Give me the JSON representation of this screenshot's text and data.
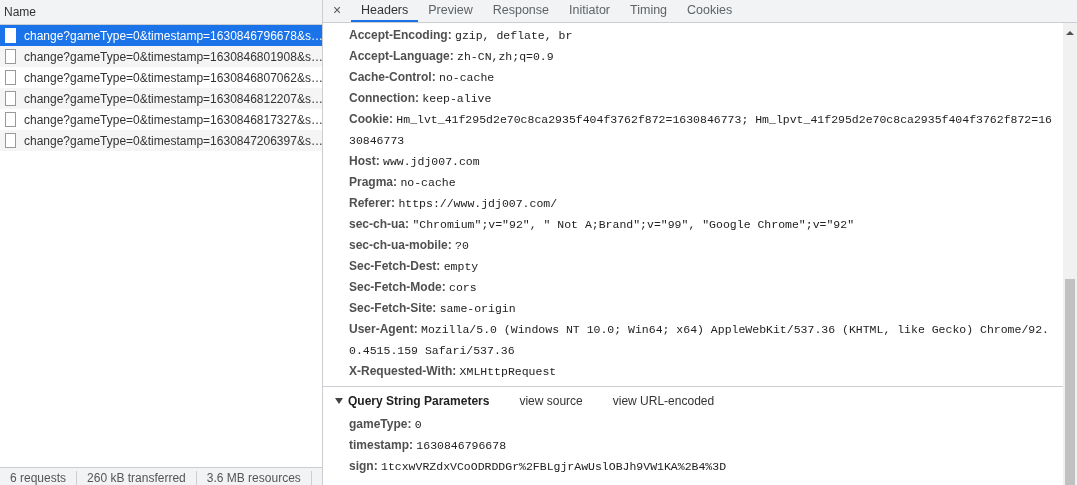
{
  "request_list": {
    "column_header": "Name",
    "requests": [
      {
        "name": "change?gameType=0&timestamp=1630846796678&s…",
        "selected": true
      },
      {
        "name": "change?gameType=0&timestamp=1630846801908&s…",
        "selected": false
      },
      {
        "name": "change?gameType=0&timestamp=1630846807062&s…",
        "selected": false
      },
      {
        "name": "change?gameType=0&timestamp=1630846812207&s…",
        "selected": false
      },
      {
        "name": "change?gameType=0&timestamp=1630846817327&s…",
        "selected": false
      },
      {
        "name": "change?gameType=0&timestamp=1630847206397&s…",
        "selected": false
      }
    ]
  },
  "status_bar": [
    "6 requests",
    "260 kB transferred",
    "3.6 MB resources"
  ],
  "detail": {
    "close": "×",
    "tabs": [
      {
        "label": "Headers",
        "selected": true
      },
      {
        "label": "Preview",
        "selected": false
      },
      {
        "label": "Response",
        "selected": false
      },
      {
        "label": "Initiator",
        "selected": false
      },
      {
        "label": "Timing",
        "selected": false
      },
      {
        "label": "Cookies",
        "selected": false
      }
    ],
    "request_headers": [
      {
        "name": "Accept-Encoding:",
        "value": "gzip, deflate, br"
      },
      {
        "name": "Accept-Language:",
        "value": "zh-CN,zh;q=0.9"
      },
      {
        "name": "Cache-Control:",
        "value": "no-cache"
      },
      {
        "name": "Connection:",
        "value": "keep-alive"
      },
      {
        "name": "Cookie:",
        "value": "Hm_lvt_41f295d2e70c8ca2935f404f3762f872=1630846773; Hm_lpvt_41f295d2e70c8ca2935f404f3762f872=1630846773"
      },
      {
        "name": "Host:",
        "value": "www.jdj007.com"
      },
      {
        "name": "Pragma:",
        "value": "no-cache"
      },
      {
        "name": "Referer:",
        "value": "https://www.jdj007.com/"
      },
      {
        "name": "sec-ch-ua:",
        "value": "\"Chromium\";v=\"92\", \" Not A;Brand\";v=\"99\", \"Google Chrome\";v=\"92\""
      },
      {
        "name": "sec-ch-ua-mobile:",
        "value": "?0"
      },
      {
        "name": "Sec-Fetch-Dest:",
        "value": "empty"
      },
      {
        "name": "Sec-Fetch-Mode:",
        "value": "cors"
      },
      {
        "name": "Sec-Fetch-Site:",
        "value": "same-origin"
      },
      {
        "name": "User-Agent:",
        "value": "Mozilla/5.0 (Windows NT 10.0; Win64; x64) AppleWebKit/537.36 (KHTML, like Gecko) Chrome/92.0.4515.159 Safari/537.36"
      },
      {
        "name": "X-Requested-With:",
        "value": "XMLHttpRequest"
      }
    ],
    "query_string_parameters": {
      "title": "Query String Parameters",
      "expanded": true,
      "links": [
        "view source",
        "view URL-encoded"
      ],
      "params": [
        {
          "name": "gameType:",
          "value": "0"
        },
        {
          "name": "timestamp:",
          "value": "1630846796678"
        },
        {
          "name": "sign:",
          "value": "1tcxwVRZdxVCoODRDDGr%2FBLgjrAwUslOBJh9VW1KA%2B4%3D"
        }
      ]
    }
  }
}
